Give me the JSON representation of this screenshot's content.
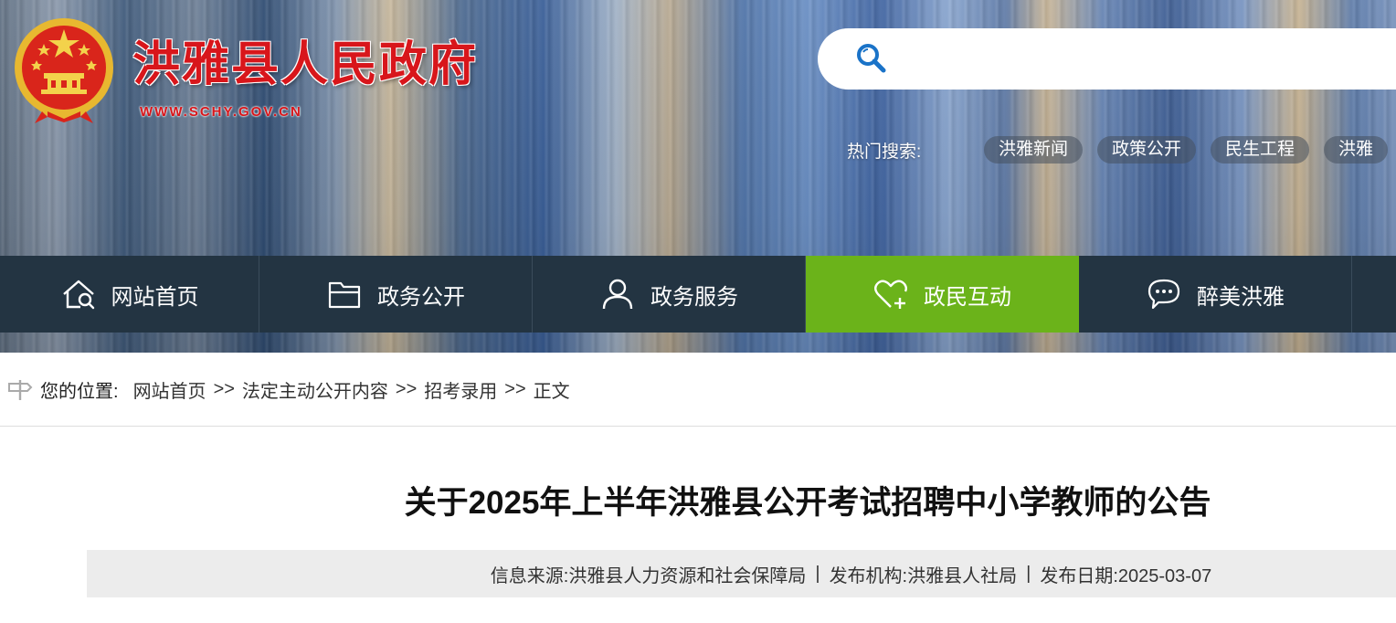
{
  "header": {
    "site_title": "洪雅县人民政府",
    "site_url": "WWW.SCHY.GOV.CN",
    "search_placeholder": "",
    "hot_label": "热门搜索:",
    "hot_tags": [
      "洪雅新闻",
      "政策公开",
      "民生工程",
      "洪雅"
    ]
  },
  "nav": {
    "items": [
      {
        "label": "网站首页",
        "icon": "home-search-icon"
      },
      {
        "label": "政务公开",
        "icon": "folder-icon"
      },
      {
        "label": "政务服务",
        "icon": "user-icon"
      },
      {
        "label": "政民互动",
        "icon": "heart-plus-icon",
        "active": true
      },
      {
        "label": "醉美洪雅",
        "icon": "chat-bubble-icon"
      }
    ]
  },
  "breadcrumb": {
    "label": "您的位置:",
    "items": [
      "网站首页",
      "法定主动公开内容",
      "招考录用",
      "正文"
    ],
    "separator": ">>"
  },
  "article": {
    "title": "关于2025年上半年洪雅县公开考试招聘中小学教师的公告",
    "source": "信息来源:洪雅县人力资源和社会保障局",
    "publisher": "发布机构:洪雅县人社局",
    "date": "发布日期:2025-03-07",
    "meta_separator": "|"
  },
  "colors": {
    "nav_bg": "#233442",
    "nav_active": "#6bb31a",
    "title_red": "#d8161b",
    "search_icon_blue": "#1a73c8"
  }
}
